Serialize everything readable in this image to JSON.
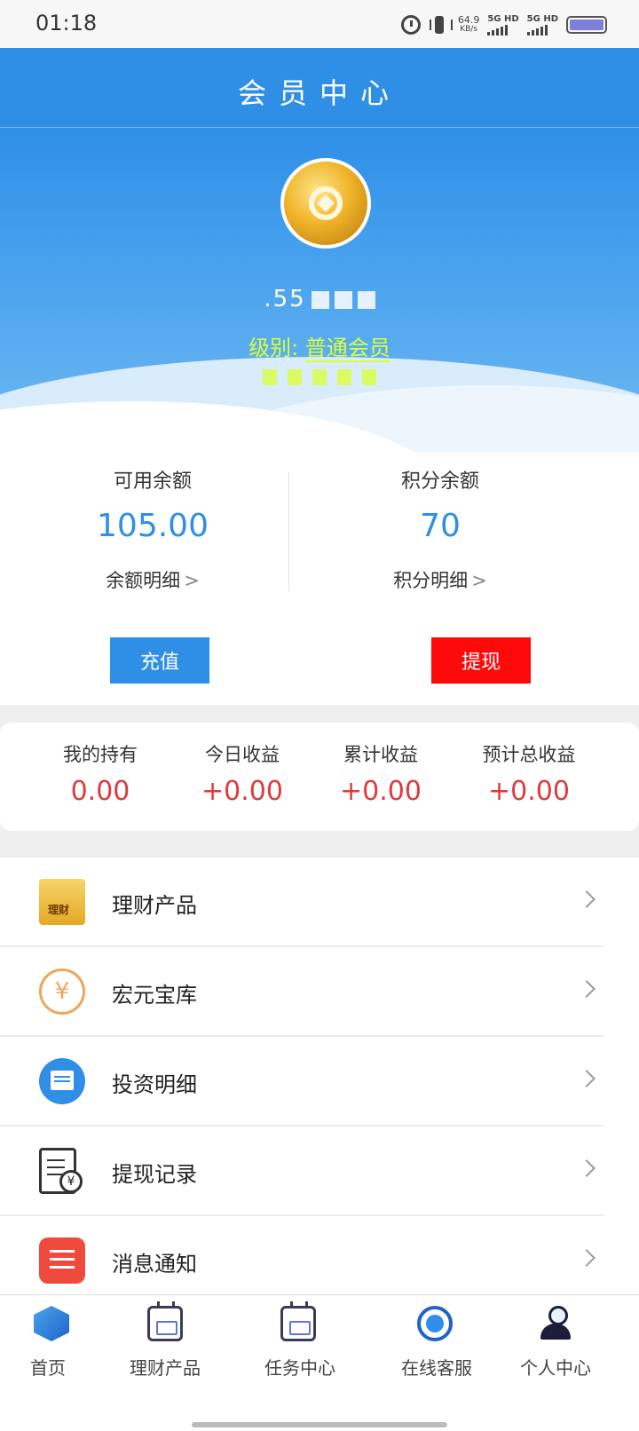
{
  "status_bar": {
    "time": "01:18",
    "net_speed": "64.9",
    "net_speed_unit": "KB/s",
    "sim1_label": "5G HD",
    "sim2_label": "5G HD",
    "icons": [
      "alarm-icon",
      "vibrate-icon",
      "signal-icon",
      "battery-icon"
    ]
  },
  "header": {
    "title": "会员中心"
  },
  "profile": {
    "username": ".55",
    "level_label": "级别:",
    "level_value": "普通会员"
  },
  "balances": {
    "available": {
      "label": "可用余额",
      "value": "105.00",
      "link": "余额明细"
    },
    "points": {
      "label": "积分余额",
      "value": "70",
      "link": "积分明细"
    },
    "recharge_label": "充值",
    "withdraw_label": "提现",
    "chevron": ">"
  },
  "earnings": [
    {
      "label": "我的持有",
      "value": "0.00"
    },
    {
      "label": "今日收益",
      "value": "+0.00"
    },
    {
      "label": "累计收益",
      "value": "+0.00"
    },
    {
      "label": "预计总收益",
      "value": "+0.00"
    }
  ],
  "menu": [
    {
      "label": "理财产品",
      "icon": "piggy-bank-icon",
      "icon_text": "理财"
    },
    {
      "label": "宏元宝库",
      "icon": "yen-coin-icon",
      "icon_text": "¥"
    },
    {
      "label": "投资明细",
      "icon": "wallet-icon"
    },
    {
      "label": "提现记录",
      "icon": "withdraw-record-icon",
      "icon_text": "¥"
    },
    {
      "label": "消息通知",
      "icon": "message-list-icon"
    }
  ],
  "bottom_nav": [
    {
      "label": "首页",
      "icon": "cube-home-icon"
    },
    {
      "label": "理财产品",
      "icon": "calendar-icon"
    },
    {
      "label": "任务中心",
      "icon": "calendar-check-icon"
    },
    {
      "label": "在线客服",
      "icon": "headset-icon"
    },
    {
      "label": "个人中心",
      "icon": "user-icon"
    }
  ],
  "colors": {
    "primary_blue": "#2f8fe6",
    "withdraw_red": "#ff0a0a",
    "earnings_red": "#e0393e",
    "level_yellow": "#d9ff3b"
  }
}
